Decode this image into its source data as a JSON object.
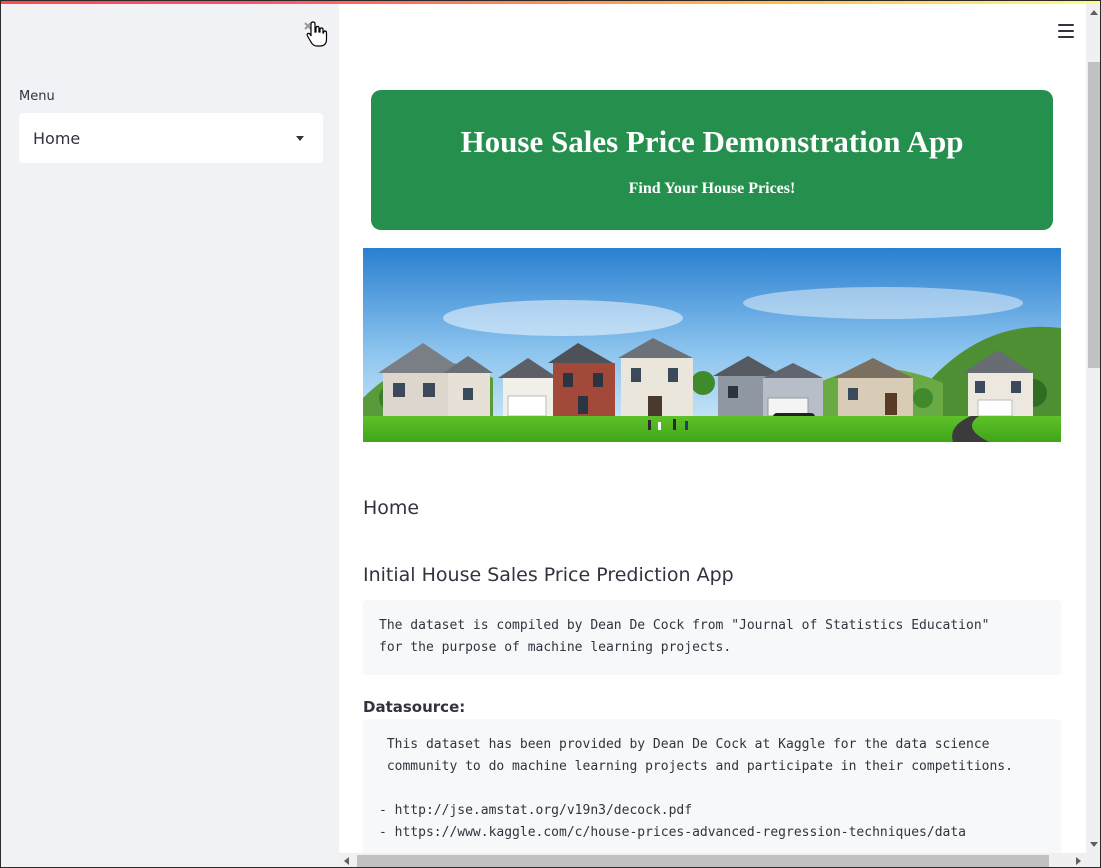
{
  "sidebar": {
    "menu_label": "Menu",
    "selected_page": "Home",
    "close_icon": "close-cursor-icon"
  },
  "header": {
    "menu_icon": "hamburger-icon"
  },
  "banner": {
    "title": "House Sales Price Demonstration App",
    "subtitle": "Find Your House Prices!",
    "background_color": "#258f4e"
  },
  "main": {
    "section_heading": "Home",
    "app_heading": "Initial House Sales Price Prediction App",
    "intro_text": "The dataset is compiled by Dean De Cock from \"Journal of Statistics Education\"\nfor the purpose of machine learning projects.",
    "datasource_label": "Datasource:",
    "datasource_text": " This dataset has been provided by Dean De Cock at Kaggle for the data science\n community to do machine learning projects and participate in their competitions.\n\n- http://jse.amstat.org/v19n3/decock.pdf\n- https://www.kaggle.com/c/house-prices-advanced-regression-techniques/data"
  }
}
